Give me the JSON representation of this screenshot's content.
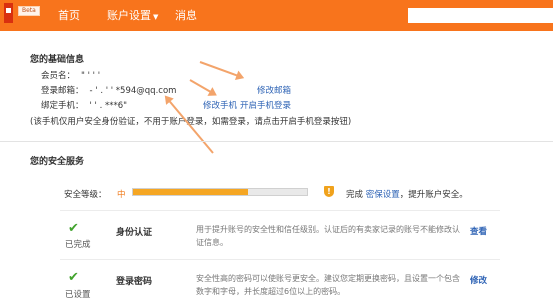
{
  "header": {
    "beta": "Beta",
    "nav": {
      "home": "首页",
      "account": "账户设置",
      "messages": "消息"
    },
    "search_placeholder": ""
  },
  "basic": {
    "title": "您的基础信息",
    "member_label": "会员名：",
    "member_value": "\" ' ' '",
    "email_label": "登录邮箱：",
    "email_value": "- ' . ' ' *594@qq.com",
    "phone_label": "绑定手机：",
    "phone_value": "' ' .  ***6\"",
    "edit_email": "修改邮箱",
    "edit_phone": "修改手机",
    "enable_phone_login": "开启手机登录",
    "note": "(该手机仅用户安全身份验证，不用于账户登录，如需登录，请点击开启手机登录按钮)"
  },
  "security": {
    "title": "您的安全服务",
    "level_label": "安全等级：",
    "level_value": "中",
    "level_percent": 0.66,
    "hint_prefix": "完成",
    "hint_link": "密保设置",
    "hint_suffix": "，提升账户安全。",
    "items": [
      {
        "status": "已完成",
        "name": "身份认证",
        "desc": "用于提升账号的安全性和信任级别。认证后的有卖家记录的账号不能修改认证信息。",
        "action": "查看"
      },
      {
        "status": "已设置",
        "name": "登录密码",
        "desc": "安全性高的密码可以使账号更安全。建议您定期更换密码，且设置一个包含数字和字母，并长度超过6位以上的密码。",
        "action": "修改"
      }
    ]
  },
  "icons": {
    "shield": "shield-icon",
    "check": "check-icon"
  },
  "colors": {
    "brand": "#f8741c",
    "link": "#2e63b5",
    "success": "#41a32d",
    "level": "#f5a623"
  }
}
